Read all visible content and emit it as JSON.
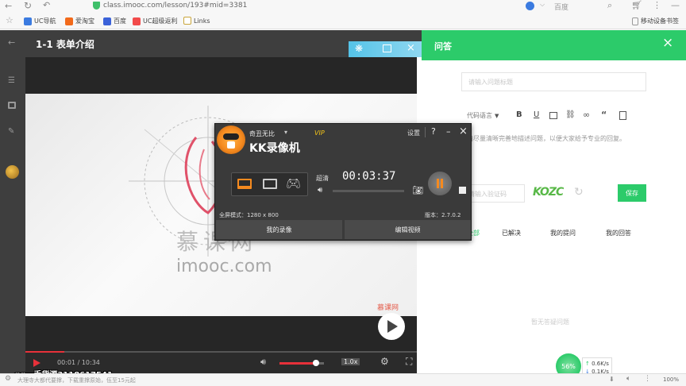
{
  "browser": {
    "url": "class.imooc.com/lesson/193#mid=3381",
    "search_engine": "百度",
    "bookmarks": [
      {
        "label": "UC导航",
        "color": "#3b7be0"
      },
      {
        "label": "爱淘宝",
        "color": "#f26a1b"
      },
      {
        "label": "百度",
        "color": "#3b62d9"
      },
      {
        "label": "UC超级返利",
        "color": "#f24b4b"
      },
      {
        "label": "Links",
        "color": "#c9a53a"
      }
    ],
    "sync_label": "移动设备书签"
  },
  "lesson": {
    "title": "1-1 表单介绍",
    "watermark_cn": "慕课网",
    "watermark_en": "imooc.com",
    "corner_logo": "慕课网",
    "time": "00:01 / 10:34",
    "progress_fraction": 0.1,
    "volume_fraction": 0.82,
    "speed": "1.0x"
  },
  "qa": {
    "header": "问答",
    "title_placeholder": "请输入问题标题",
    "toolbar_lang": "代码语言",
    "body_placeholder": "请尽量清晰完善地描述问题，以便大家给予专业的回复。",
    "captcha_placeholder": "请输入验证码",
    "captcha_text": "KOZC",
    "save_label": "保存",
    "tabs": [
      "全部",
      "已解决",
      "我的提问",
      "我的回答"
    ],
    "empty_text": "暂无答疑问题"
  },
  "recorder": {
    "user": "奇丑无比",
    "vip": "VIP",
    "settings": "设置",
    "app_name": "KK录像机",
    "quality": "超清",
    "timer": "00:03:37",
    "mode_label": "全屏模式：1280 x 800",
    "version_label": "版本：2.7.0.2",
    "my_recordings": "我的录像",
    "edit_video": "编辑视频"
  },
  "status": {
    "qq_overlay": "qq一手货源3118617541",
    "ticker": "大理寺大都代要撑，下载重撑原始，伍至15元起",
    "speed_percent": "56%",
    "upload": "0.6K/s",
    "download": "0.1K/s",
    "zoom": "100%"
  },
  "colors": {
    "accent_green": "#2ccb6a",
    "player_red": "#e7313a",
    "recorder_orange": "#f58a1f"
  }
}
